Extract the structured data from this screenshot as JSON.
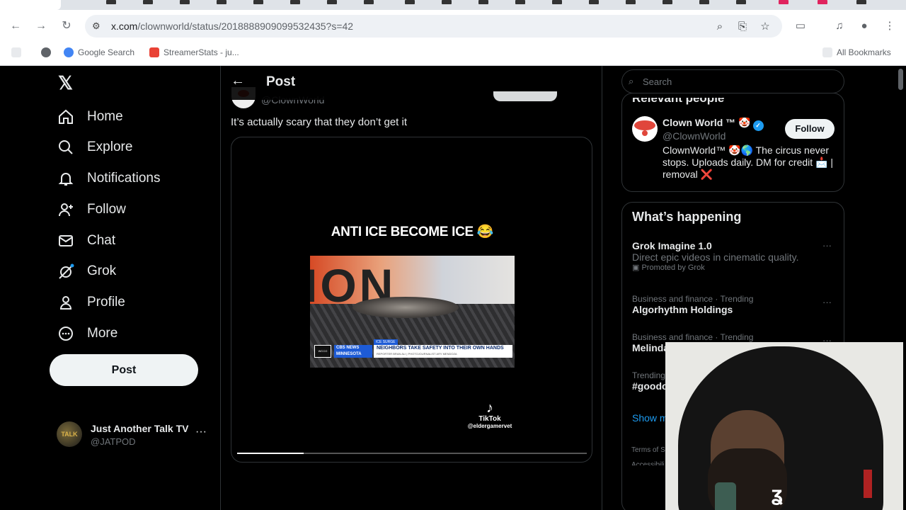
{
  "browser": {
    "url_host": "x.com",
    "url_path": "/clownworld/status/2018888909099532435?s=42",
    "bookmarks": [
      {
        "label": "Google Search",
        "color": "#4285f4"
      },
      {
        "label": "StreamerStats - ju...",
        "color": "#e94235"
      }
    ],
    "all_bookmarks_label": "All Bookmarks"
  },
  "sidebar": {
    "nav": [
      {
        "label": "Home",
        "icon": "home-icon"
      },
      {
        "label": "Explore",
        "icon": "search-icon"
      },
      {
        "label": "Notifications",
        "icon": "bell-icon"
      },
      {
        "label": "Follow",
        "icon": "person-add-icon"
      },
      {
        "label": "Chat",
        "icon": "mail-icon"
      },
      {
        "label": "Grok",
        "icon": "grok-icon"
      },
      {
        "label": "Profile",
        "icon": "person-icon"
      },
      {
        "label": "More",
        "icon": "more-circle-icon"
      }
    ],
    "post_label": "Post",
    "account": {
      "name": "Just Another Talk TV",
      "handle": "@JATPOD",
      "avatar_text": "TALK"
    }
  },
  "post": {
    "header_title": "Post",
    "author_handle": "@ClownWorld",
    "text": "It’s actually scary that they don’t get it",
    "media": {
      "overlay_text": "ANTI ICE BECOME ICE 😂",
      "chyron_brand": "CBS NEWS",
      "chyron_region": "MINNESOTA",
      "chyron_tag": "ICE SURGE",
      "chyron_headline": "NEIGHBORS TAKE SAFETY INTO THEIR OWN HANDS",
      "chyron_sub": "REPORTER BRAN ALI | PHOTOJOURNALIST ARY MENDOZA",
      "station_logo": "WCCO",
      "tiktok_brand": "TikTok",
      "tiktok_user": "@eldergamervet",
      "progress_fraction": 0.19
    }
  },
  "right": {
    "search_placeholder": "Search",
    "relevant_title": "Relevant people",
    "person": {
      "name": "Clown World ™ 🤡",
      "handle": "@ClownWorld",
      "bio": "ClownWorld™ 🤡🌎 The circus never stops. Uploads daily. DM for credit 📩 | removal ❌",
      "follow_label": "Follow"
    },
    "happening_title": "What’s happening",
    "trends": [
      {
        "meta": "",
        "title": "Grok Imagine 1.0",
        "desc": "Direct epic videos in cinematic quality.",
        "promo": "Promoted by Grok"
      },
      {
        "meta": "Business and finance · Trending",
        "title": "Algorhythm Holdings",
        "desc": "",
        "promo": ""
      },
      {
        "meta": "Business and finance · Trending",
        "title": "Melinda",
        "desc": "",
        "promo": ""
      },
      {
        "meta": "Trending",
        "title": "#goodo",
        "desc": "",
        "promo": ""
      }
    ],
    "show_more": "Show m",
    "footer_1": "Terms of S",
    "footer_2": "Accessibili"
  }
}
